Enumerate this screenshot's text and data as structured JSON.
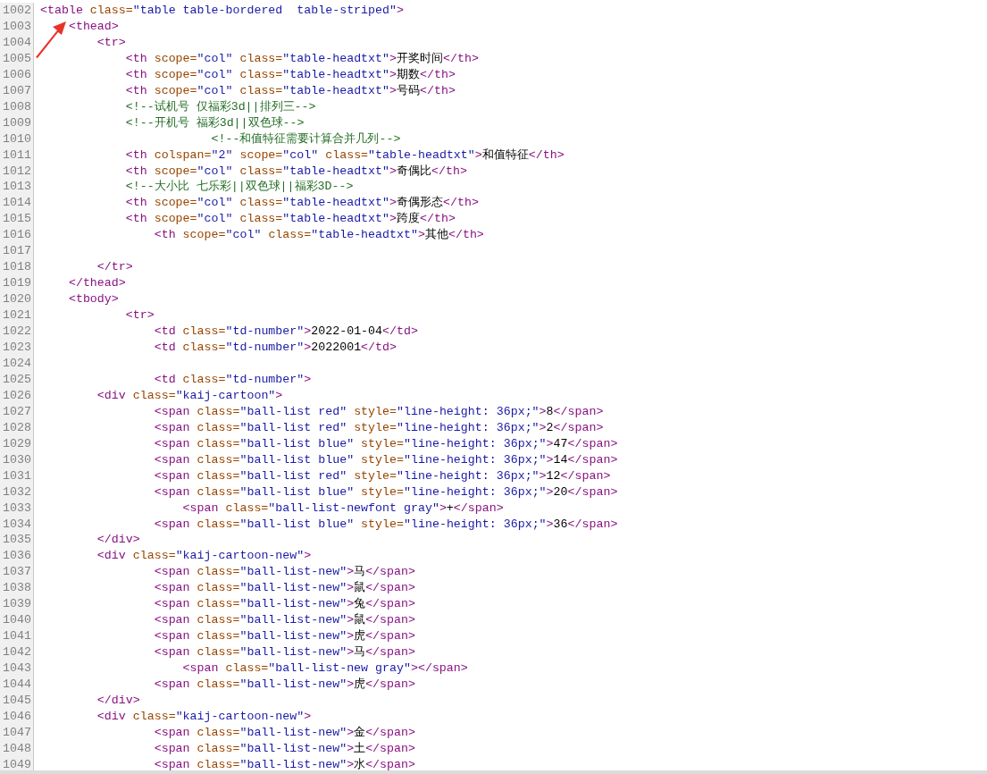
{
  "lines": [
    {
      "number": "1002",
      "tokens": [
        {
          "kind": "tag",
          "text": "<table "
        },
        {
          "kind": "attr",
          "text": "class="
        },
        {
          "kind": "value",
          "text": "\"table table-bordered  table-striped\""
        },
        {
          "kind": "tag",
          "text": ">"
        }
      ]
    },
    {
      "number": "1003",
      "tokens": [
        {
          "kind": "tag",
          "text": "    <thead>"
        }
      ]
    },
    {
      "number": "1004",
      "tokens": [
        {
          "kind": "tag",
          "text": "        <tr>"
        }
      ]
    },
    {
      "number": "1005",
      "tokens": [
        {
          "kind": "tag",
          "text": "            <th "
        },
        {
          "kind": "attr",
          "text": "scope="
        },
        {
          "kind": "value",
          "text": "\"col\" "
        },
        {
          "kind": "attr",
          "text": "class="
        },
        {
          "kind": "value",
          "text": "\"table-headtxt\""
        },
        {
          "kind": "tag",
          "text": ">"
        },
        {
          "kind": "text",
          "text": "开奖时间"
        },
        {
          "kind": "tag",
          "text": "</th>"
        }
      ]
    },
    {
      "number": "1006",
      "tokens": [
        {
          "kind": "tag",
          "text": "            <th "
        },
        {
          "kind": "attr",
          "text": "scope="
        },
        {
          "kind": "value",
          "text": "\"col\" "
        },
        {
          "kind": "attr",
          "text": "class="
        },
        {
          "kind": "value",
          "text": "\"table-headtxt\""
        },
        {
          "kind": "tag",
          "text": ">"
        },
        {
          "kind": "text",
          "text": "期数"
        },
        {
          "kind": "tag",
          "text": "</th>"
        }
      ]
    },
    {
      "number": "1007",
      "tokens": [
        {
          "kind": "tag",
          "text": "            <th "
        },
        {
          "kind": "attr",
          "text": "scope="
        },
        {
          "kind": "value",
          "text": "\"col\" "
        },
        {
          "kind": "attr",
          "text": "class="
        },
        {
          "kind": "value",
          "text": "\"table-headtxt\""
        },
        {
          "kind": "tag",
          "text": ">"
        },
        {
          "kind": "text",
          "text": "号码"
        },
        {
          "kind": "tag",
          "text": "</th>"
        }
      ]
    },
    {
      "number": "1008",
      "tokens": [
        {
          "kind": "comment",
          "text": "            <!--试机号 仅福彩3d||排列三-->"
        }
      ]
    },
    {
      "number": "1009",
      "tokens": [
        {
          "kind": "comment",
          "text": "            <!--开机号 福彩3d||双色球-->"
        }
      ]
    },
    {
      "number": "1010",
      "tokens": [
        {
          "kind": "comment",
          "text": "                        <!--和值特征需要计算合并几列-->"
        }
      ]
    },
    {
      "number": "1011",
      "tokens": [
        {
          "kind": "tag",
          "text": "            <th "
        },
        {
          "kind": "attr",
          "text": "colspan="
        },
        {
          "kind": "value",
          "text": "\"2\" "
        },
        {
          "kind": "attr",
          "text": "scope="
        },
        {
          "kind": "value",
          "text": "\"col\" "
        },
        {
          "kind": "attr",
          "text": "class="
        },
        {
          "kind": "value",
          "text": "\"table-headtxt\""
        },
        {
          "kind": "tag",
          "text": ">"
        },
        {
          "kind": "text",
          "text": "和值特征"
        },
        {
          "kind": "tag",
          "text": "</th>"
        }
      ]
    },
    {
      "number": "1012",
      "tokens": [
        {
          "kind": "tag",
          "text": "            <th "
        },
        {
          "kind": "attr",
          "text": "scope="
        },
        {
          "kind": "value",
          "text": "\"col\" "
        },
        {
          "kind": "attr",
          "text": "class="
        },
        {
          "kind": "value",
          "text": "\"table-headtxt\""
        },
        {
          "kind": "tag",
          "text": ">"
        },
        {
          "kind": "text",
          "text": "奇偶比"
        },
        {
          "kind": "tag",
          "text": "</th>"
        }
      ]
    },
    {
      "number": "1013",
      "tokens": [
        {
          "kind": "comment",
          "text": "            <!--大小比 七乐彩||双色球||福彩3D-->"
        }
      ]
    },
    {
      "number": "1014",
      "tokens": [
        {
          "kind": "tag",
          "text": "            <th "
        },
        {
          "kind": "attr",
          "text": "scope="
        },
        {
          "kind": "value",
          "text": "\"col\" "
        },
        {
          "kind": "attr",
          "text": "class="
        },
        {
          "kind": "value",
          "text": "\"table-headtxt\""
        },
        {
          "kind": "tag",
          "text": ">"
        },
        {
          "kind": "text",
          "text": "奇偶形态"
        },
        {
          "kind": "tag",
          "text": "</th>"
        }
      ]
    },
    {
      "number": "1015",
      "tokens": [
        {
          "kind": "tag",
          "text": "            <th "
        },
        {
          "kind": "attr",
          "text": "scope="
        },
        {
          "kind": "value",
          "text": "\"col\" "
        },
        {
          "kind": "attr",
          "text": "class="
        },
        {
          "kind": "value",
          "text": "\"table-headtxt\""
        },
        {
          "kind": "tag",
          "text": ">"
        },
        {
          "kind": "text",
          "text": "跨度"
        },
        {
          "kind": "tag",
          "text": "</th>"
        }
      ]
    },
    {
      "number": "1016",
      "tokens": [
        {
          "kind": "tag",
          "text": "                <th "
        },
        {
          "kind": "attr",
          "text": "scope="
        },
        {
          "kind": "value",
          "text": "\"col\" "
        },
        {
          "kind": "attr",
          "text": "class="
        },
        {
          "kind": "value",
          "text": "\"table-headtxt\""
        },
        {
          "kind": "tag",
          "text": ">"
        },
        {
          "kind": "text",
          "text": "其他"
        },
        {
          "kind": "tag",
          "text": "</th>"
        }
      ]
    },
    {
      "number": "1017"
    },
    {
      "number": "1018",
      "tokens": [
        {
          "kind": "tag",
          "text": "        </tr>"
        }
      ]
    },
    {
      "number": "1019",
      "tokens": [
        {
          "kind": "tag",
          "text": "    </thead>"
        }
      ]
    },
    {
      "number": "1020",
      "tokens": [
        {
          "kind": "tag",
          "text": "    <tbody>"
        }
      ]
    },
    {
      "number": "1021",
      "tokens": [
        {
          "kind": "tag",
          "text": "            <tr>"
        }
      ]
    },
    {
      "number": "1022",
      "tokens": [
        {
          "kind": "tag",
          "text": "                <td "
        },
        {
          "kind": "attr",
          "text": "class="
        },
        {
          "kind": "value",
          "text": "\"td-number\""
        },
        {
          "kind": "tag",
          "text": ">"
        },
        {
          "kind": "text",
          "text": "2022-01-04"
        },
        {
          "kind": "tag",
          "text": "</td>"
        }
      ]
    },
    {
      "number": "1023",
      "tokens": [
        {
          "kind": "tag",
          "text": "                <td "
        },
        {
          "kind": "attr",
          "text": "class="
        },
        {
          "kind": "value",
          "text": "\"td-number\""
        },
        {
          "kind": "tag",
          "text": ">"
        },
        {
          "kind": "text",
          "text": "2022001"
        },
        {
          "kind": "tag",
          "text": "</td>"
        }
      ]
    },
    {
      "number": "1024"
    },
    {
      "number": "1025",
      "tokens": [
        {
          "kind": "tag",
          "text": "                <td "
        },
        {
          "kind": "attr",
          "text": "class="
        },
        {
          "kind": "value",
          "text": "\"td-number\""
        },
        {
          "kind": "tag",
          "text": ">"
        }
      ]
    },
    {
      "number": "1026",
      "tokens": [
        {
          "kind": "tag",
          "text": "        <div "
        },
        {
          "kind": "attr",
          "text": "class="
        },
        {
          "kind": "value",
          "text": "\"kaij-cartoon\""
        },
        {
          "kind": "tag",
          "text": ">"
        }
      ]
    },
    {
      "number": "1027",
      "tokens": [
        {
          "kind": "tag",
          "text": "                <span "
        },
        {
          "kind": "attr",
          "text": "class="
        },
        {
          "kind": "value",
          "text": "\"ball-list red\" "
        },
        {
          "kind": "attr",
          "text": "style="
        },
        {
          "kind": "value",
          "text": "\"line-height: 36px;\""
        },
        {
          "kind": "tag",
          "text": ">"
        },
        {
          "kind": "text",
          "text": "8"
        },
        {
          "kind": "tag",
          "text": "</span>"
        }
      ]
    },
    {
      "number": "1028",
      "tokens": [
        {
          "kind": "tag",
          "text": "                <span "
        },
        {
          "kind": "attr",
          "text": "class="
        },
        {
          "kind": "value",
          "text": "\"ball-list red\" "
        },
        {
          "kind": "attr",
          "text": "style="
        },
        {
          "kind": "value",
          "text": "\"line-height: 36px;\""
        },
        {
          "kind": "tag",
          "text": ">"
        },
        {
          "kind": "text",
          "text": "2"
        },
        {
          "kind": "tag",
          "text": "</span>"
        }
      ]
    },
    {
      "number": "1029",
      "tokens": [
        {
          "kind": "tag",
          "text": "                <span "
        },
        {
          "kind": "attr",
          "text": "class="
        },
        {
          "kind": "value",
          "text": "\"ball-list blue\" "
        },
        {
          "kind": "attr",
          "text": "style="
        },
        {
          "kind": "value",
          "text": "\"line-height: 36px;\""
        },
        {
          "kind": "tag",
          "text": ">"
        },
        {
          "kind": "text",
          "text": "47"
        },
        {
          "kind": "tag",
          "text": "</span>"
        }
      ]
    },
    {
      "number": "1030",
      "tokens": [
        {
          "kind": "tag",
          "text": "                <span "
        },
        {
          "kind": "attr",
          "text": "class="
        },
        {
          "kind": "value",
          "text": "\"ball-list blue\" "
        },
        {
          "kind": "attr",
          "text": "style="
        },
        {
          "kind": "value",
          "text": "\"line-height: 36px;\""
        },
        {
          "kind": "tag",
          "text": ">"
        },
        {
          "kind": "text",
          "text": "14"
        },
        {
          "kind": "tag",
          "text": "</span>"
        }
      ]
    },
    {
      "number": "1031",
      "tokens": [
        {
          "kind": "tag",
          "text": "                <span "
        },
        {
          "kind": "attr",
          "text": "class="
        },
        {
          "kind": "value",
          "text": "\"ball-list red\" "
        },
        {
          "kind": "attr",
          "text": "style="
        },
        {
          "kind": "value",
          "text": "\"line-height: 36px;\""
        },
        {
          "kind": "tag",
          "text": ">"
        },
        {
          "kind": "text",
          "text": "12"
        },
        {
          "kind": "tag",
          "text": "</span>"
        }
      ]
    },
    {
      "number": "1032",
      "tokens": [
        {
          "kind": "tag",
          "text": "                <span "
        },
        {
          "kind": "attr",
          "text": "class="
        },
        {
          "kind": "value",
          "text": "\"ball-list blue\" "
        },
        {
          "kind": "attr",
          "text": "style="
        },
        {
          "kind": "value",
          "text": "\"line-height: 36px;\""
        },
        {
          "kind": "tag",
          "text": ">"
        },
        {
          "kind": "text",
          "text": "20"
        },
        {
          "kind": "tag",
          "text": "</span>"
        }
      ]
    },
    {
      "number": "1033",
      "tokens": [
        {
          "kind": "tag",
          "text": "                    <span "
        },
        {
          "kind": "attr",
          "text": "class="
        },
        {
          "kind": "value",
          "text": "\"ball-list-newfont gray\""
        },
        {
          "kind": "tag",
          "text": ">"
        },
        {
          "kind": "text",
          "text": "+"
        },
        {
          "kind": "tag",
          "text": "</span>"
        }
      ]
    },
    {
      "number": "1034",
      "tokens": [
        {
          "kind": "tag",
          "text": "                <span "
        },
        {
          "kind": "attr",
          "text": "class="
        },
        {
          "kind": "value",
          "text": "\"ball-list blue\" "
        },
        {
          "kind": "attr",
          "text": "style="
        },
        {
          "kind": "value",
          "text": "\"line-height: 36px;\""
        },
        {
          "kind": "tag",
          "text": ">"
        },
        {
          "kind": "text",
          "text": "36"
        },
        {
          "kind": "tag",
          "text": "</span>"
        }
      ]
    },
    {
      "number": "1035",
      "tokens": [
        {
          "kind": "tag",
          "text": "        </div>"
        }
      ]
    },
    {
      "number": "1036",
      "tokens": [
        {
          "kind": "tag",
          "text": "        <div "
        },
        {
          "kind": "attr",
          "text": "class="
        },
        {
          "kind": "value",
          "text": "\"kaij-cartoon-new\""
        },
        {
          "kind": "tag",
          "text": ">"
        }
      ]
    },
    {
      "number": "1037",
      "tokens": [
        {
          "kind": "tag",
          "text": "                <span "
        },
        {
          "kind": "attr",
          "text": "class="
        },
        {
          "kind": "value",
          "text": "\"ball-list-new\""
        },
        {
          "kind": "tag",
          "text": ">"
        },
        {
          "kind": "text",
          "text": "马"
        },
        {
          "kind": "tag",
          "text": "</span>"
        }
      ]
    },
    {
      "number": "1038",
      "tokens": [
        {
          "kind": "tag",
          "text": "                <span "
        },
        {
          "kind": "attr",
          "text": "class="
        },
        {
          "kind": "value",
          "text": "\"ball-list-new\""
        },
        {
          "kind": "tag",
          "text": ">"
        },
        {
          "kind": "text",
          "text": "鼠"
        },
        {
          "kind": "tag",
          "text": "</span>"
        }
      ]
    },
    {
      "number": "1039",
      "tokens": [
        {
          "kind": "tag",
          "text": "                <span "
        },
        {
          "kind": "attr",
          "text": "class="
        },
        {
          "kind": "value",
          "text": "\"ball-list-new\""
        },
        {
          "kind": "tag",
          "text": ">"
        },
        {
          "kind": "text",
          "text": "兔"
        },
        {
          "kind": "tag",
          "text": "</span>"
        }
      ]
    },
    {
      "number": "1040",
      "tokens": [
        {
          "kind": "tag",
          "text": "                <span "
        },
        {
          "kind": "attr",
          "text": "class="
        },
        {
          "kind": "value",
          "text": "\"ball-list-new\""
        },
        {
          "kind": "tag",
          "text": ">"
        },
        {
          "kind": "text",
          "text": "鼠"
        },
        {
          "kind": "tag",
          "text": "</span>"
        }
      ]
    },
    {
      "number": "1041",
      "tokens": [
        {
          "kind": "tag",
          "text": "                <span "
        },
        {
          "kind": "attr",
          "text": "class="
        },
        {
          "kind": "value",
          "text": "\"ball-list-new\""
        },
        {
          "kind": "tag",
          "text": ">"
        },
        {
          "kind": "text",
          "text": "虎"
        },
        {
          "kind": "tag",
          "text": "</span>"
        }
      ]
    },
    {
      "number": "1042",
      "tokens": [
        {
          "kind": "tag",
          "text": "                <span "
        },
        {
          "kind": "attr",
          "text": "class="
        },
        {
          "kind": "value",
          "text": "\"ball-list-new\""
        },
        {
          "kind": "tag",
          "text": ">"
        },
        {
          "kind": "text",
          "text": "马"
        },
        {
          "kind": "tag",
          "text": "</span>"
        }
      ]
    },
    {
      "number": "1043",
      "tokens": [
        {
          "kind": "tag",
          "text": "                    <span "
        },
        {
          "kind": "attr",
          "text": "class="
        },
        {
          "kind": "value",
          "text": "\"ball-list-new gray\""
        },
        {
          "kind": "tag",
          "text": "></span>"
        }
      ]
    },
    {
      "number": "1044",
      "tokens": [
        {
          "kind": "tag",
          "text": "                <span "
        },
        {
          "kind": "attr",
          "text": "class="
        },
        {
          "kind": "value",
          "text": "\"ball-list-new\""
        },
        {
          "kind": "tag",
          "text": ">"
        },
        {
          "kind": "text",
          "text": "虎"
        },
        {
          "kind": "tag",
          "text": "</span>"
        }
      ]
    },
    {
      "number": "1045",
      "tokens": [
        {
          "kind": "tag",
          "text": "        </div>"
        }
      ]
    },
    {
      "number": "1046",
      "tokens": [
        {
          "kind": "tag",
          "text": "        <div "
        },
        {
          "kind": "attr",
          "text": "class="
        },
        {
          "kind": "value",
          "text": "\"kaij-cartoon-new\""
        },
        {
          "kind": "tag",
          "text": ">"
        }
      ]
    },
    {
      "number": "1047",
      "tokens": [
        {
          "kind": "tag",
          "text": "                <span "
        },
        {
          "kind": "attr",
          "text": "class="
        },
        {
          "kind": "value",
          "text": "\"ball-list-new\""
        },
        {
          "kind": "tag",
          "text": ">"
        },
        {
          "kind": "text",
          "text": "金"
        },
        {
          "kind": "tag",
          "text": "</span>"
        }
      ]
    },
    {
      "number": "1048",
      "tokens": [
        {
          "kind": "tag",
          "text": "                <span "
        },
        {
          "kind": "attr",
          "text": "class="
        },
        {
          "kind": "value",
          "text": "\"ball-list-new\""
        },
        {
          "kind": "tag",
          "text": ">"
        },
        {
          "kind": "text",
          "text": "土"
        },
        {
          "kind": "tag",
          "text": "</span>"
        }
      ]
    },
    {
      "number": "1049",
      "tokens": [
        {
          "kind": "tag",
          "text": "                <span "
        },
        {
          "kind": "attr",
          "text": "class="
        },
        {
          "kind": "value",
          "text": "\"ball-list-new\""
        },
        {
          "kind": "tag",
          "text": ">"
        },
        {
          "kind": "text",
          "text": "水"
        },
        {
          "kind": "tag",
          "text": "</span>"
        }
      ]
    }
  ]
}
